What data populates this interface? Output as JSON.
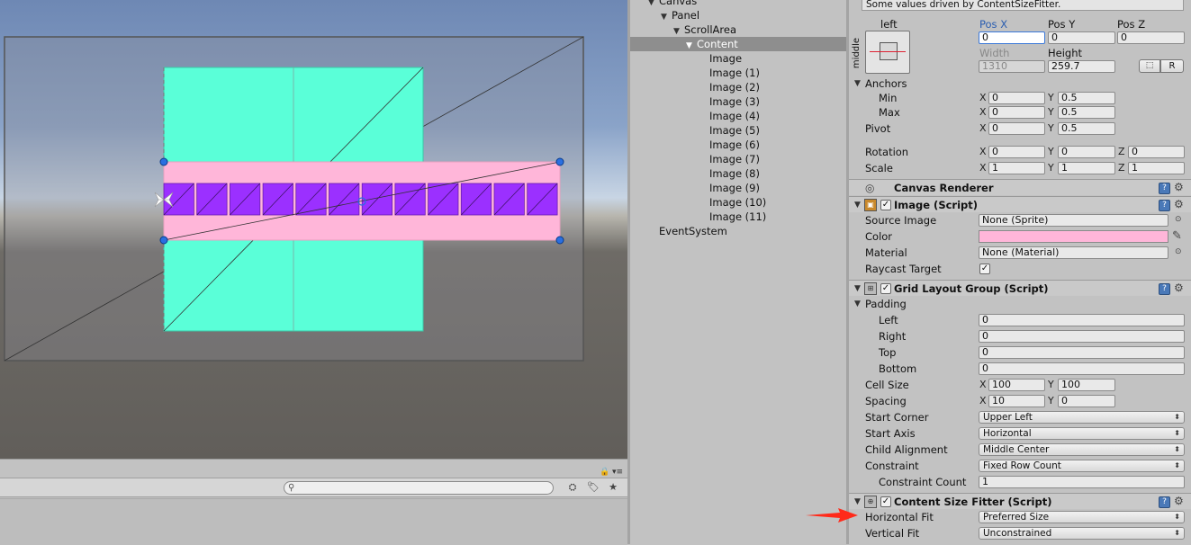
{
  "hierarchy": {
    "items": [
      {
        "label": "Canvas",
        "depth": 1,
        "arrow": "▼",
        "selected": false
      },
      {
        "label": "Panel",
        "depth": 2,
        "arrow": "▼",
        "selected": false
      },
      {
        "label": "ScrollArea",
        "depth": 3,
        "arrow": "▼",
        "selected": false
      },
      {
        "label": "Content",
        "depth": 4,
        "arrow": "▼",
        "selected": true
      },
      {
        "label": "Image",
        "depth": 5,
        "arrow": "",
        "selected": false
      },
      {
        "label": "Image (1)",
        "depth": 5,
        "arrow": "",
        "selected": false
      },
      {
        "label": "Image (2)",
        "depth": 5,
        "arrow": "",
        "selected": false
      },
      {
        "label": "Image (3)",
        "depth": 5,
        "arrow": "",
        "selected": false
      },
      {
        "label": "Image (4)",
        "depth": 5,
        "arrow": "",
        "selected": false
      },
      {
        "label": "Image (5)",
        "depth": 5,
        "arrow": "",
        "selected": false
      },
      {
        "label": "Image (6)",
        "depth": 5,
        "arrow": "",
        "selected": false
      },
      {
        "label": "Image (7)",
        "depth": 5,
        "arrow": "",
        "selected": false
      },
      {
        "label": "Image (8)",
        "depth": 5,
        "arrow": "",
        "selected": false
      },
      {
        "label": "Image (9)",
        "depth": 5,
        "arrow": "",
        "selected": false
      },
      {
        "label": "Image (10)",
        "depth": 5,
        "arrow": "",
        "selected": false
      },
      {
        "label": "Image (11)",
        "depth": 5,
        "arrow": "",
        "selected": false
      },
      {
        "label": "EventSystem",
        "depth": 1,
        "arrow": "",
        "selected": false
      }
    ]
  },
  "inspector": {
    "driven_info": "Some values driven by ContentSizeFitter.",
    "rect": {
      "anchor_h_label": "left",
      "anchor_v_label": "middle",
      "pos_x_label": "Pos X",
      "pos_y_label": "Pos Y",
      "pos_z_label": "Pos Z",
      "pos_x": "0",
      "pos_y": "0",
      "pos_z": "0",
      "width_label": "Width",
      "height_label": "Height",
      "width": "1310",
      "height": "259.7",
      "raw_button": "R",
      "anchors_label": "Anchors",
      "min_label": "Min",
      "max_label": "Max",
      "min_x": "0",
      "min_y": "0.5",
      "max_x": "0",
      "max_y": "0.5",
      "pivot_label": "Pivot",
      "pivot_x": "0",
      "pivot_y": "0.5",
      "rotation_label": "Rotation",
      "rot_x": "0",
      "rot_y": "0",
      "rot_z": "0",
      "scale_label": "Scale",
      "scale_x": "1",
      "scale_y": "1",
      "scale_z": "1",
      "x": "X",
      "y": "Y",
      "z": "Z"
    },
    "canvas_renderer": {
      "title": "Canvas Renderer"
    },
    "image": {
      "title": "Image (Script)",
      "source_image_label": "Source Image",
      "source_image": "None (Sprite)",
      "color_label": "Color",
      "color": "#ffb6d9",
      "material_label": "Material",
      "material": "None (Material)",
      "raycast_label": "Raycast Target"
    },
    "grid": {
      "title": "Grid Layout Group (Script)",
      "padding_label": "Padding",
      "left_label": "Left",
      "left": "0",
      "right_label": "Right",
      "right": "0",
      "top_label": "Top",
      "top": "0",
      "bottom_label": "Bottom",
      "bottom": "0",
      "cell_size_label": "Cell Size",
      "cell_x": "100",
      "cell_y": "100",
      "spacing_label": "Spacing",
      "spacing_x": "10",
      "spacing_y": "0",
      "start_corner_label": "Start Corner",
      "start_corner": "Upper Left",
      "start_axis_label": "Start Axis",
      "start_axis": "Horizontal",
      "child_alignment_label": "Child Alignment",
      "child_alignment": "Middle Center",
      "constraint_label": "Constraint",
      "constraint": "Fixed Row Count",
      "constraint_count_label": "Constraint Count",
      "constraint_count": "1"
    },
    "fitter": {
      "title": "Content Size Fitter (Script)",
      "horizontal_fit_label": "Horizontal Fit",
      "horizontal_fit": "Preferred Size",
      "vertical_fit_label": "Vertical Fit",
      "vertical_fit": "Unconstrained"
    }
  },
  "colors": {
    "cyan_image": "#5affd8",
    "pink_content": "#ffb6d9",
    "purple_cells": "#9b30ff",
    "annotation_arrow": "#ff2a1a",
    "handle_blue": "#2a6fe0"
  },
  "scene": {
    "cell_count": 12
  }
}
